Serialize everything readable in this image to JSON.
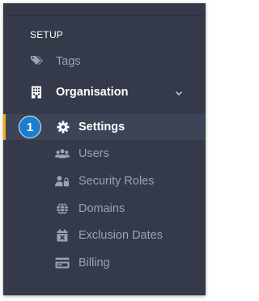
{
  "nav": {
    "section_label": "SETUP",
    "items": [
      {
        "label": "Tags",
        "icon": "tag-icon"
      },
      {
        "label": "Organisation",
        "icon": "building-icon",
        "expanded": true
      }
    ],
    "active": {
      "label": "Settings",
      "icon": "gear-icon",
      "step_number": "1"
    },
    "sub_items": [
      {
        "label": "Users",
        "icon": "users-icon"
      },
      {
        "label": "Security Roles",
        "icon": "user-lock-icon"
      },
      {
        "label": "Domains",
        "icon": "globe-icon"
      },
      {
        "label": "Exclusion Dates",
        "icon": "calendar-x-icon"
      },
      {
        "label": "Billing",
        "icon": "credit-card-icon"
      }
    ]
  },
  "colors": {
    "background": "#343a49",
    "active_row": "#3d4455",
    "accent": "#f4a81d",
    "badge": "#1a7fcf",
    "muted_text": "#9aa2b3"
  }
}
